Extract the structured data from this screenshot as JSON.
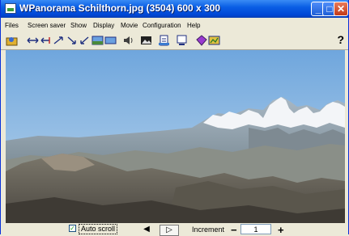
{
  "window": {
    "title": "WPanorama  Schilthorn.jpg   (3504) 600 x 300",
    "minimize_label": "_",
    "maximize_label": "□",
    "close_label": "✕"
  },
  "menu": {
    "items": [
      {
        "label": "Files"
      },
      {
        "label": "Screen saver"
      },
      {
        "label": "Show"
      },
      {
        "label": "Display"
      },
      {
        "label": "Movie"
      },
      {
        "label": "Configuration"
      },
      {
        "label": "Help"
      }
    ]
  },
  "toolbar": {
    "icons": [
      "open-icon",
      "move-left-right-icon",
      "scroll-left-icon",
      "scroll-right-icon",
      "speed-up-icon",
      "speed-down-icon",
      "fit-icon",
      "sound-icon",
      "image-icon",
      "landscape-icon",
      "document-icon",
      "screensaver-icon",
      "bookmark-icon"
    ],
    "help_label": "?"
  },
  "bottom": {
    "auto_scroll_label": "Auto scroll",
    "auto_scroll_checked": true,
    "prev_label": "◀",
    "next_label": "▷",
    "increment_label": "Increment",
    "increment_minus": "−",
    "increment_value": "1",
    "increment_plus": "+"
  }
}
